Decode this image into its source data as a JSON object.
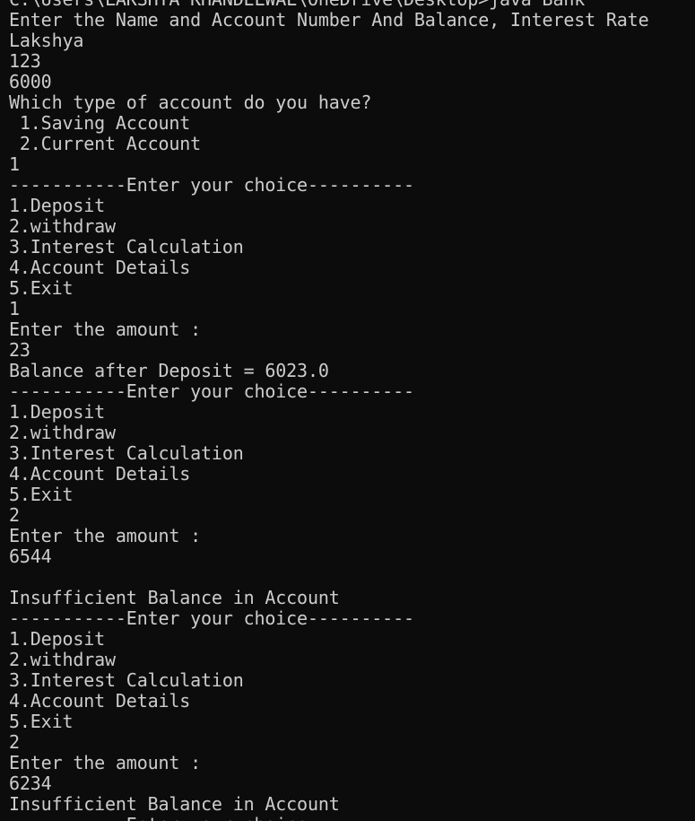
{
  "console": {
    "lines": [
      "C:\\Users\\LAKSHYA KHANDELWAL\\OneDrive\\Desktop>java Bank",
      "Enter the Name and Account Number And Balance, Interest Rate",
      "Lakshya",
      "123",
      "6000",
      "Which type of account do you have?",
      " 1.Saving Account",
      " 2.Current Account",
      "1",
      "-----------Enter your choice----------",
      "1.Deposit",
      "2.withdraw",
      "3.Interest Calculation",
      "4.Account Details",
      "5.Exit",
      "1",
      "Enter the amount :",
      "23",
      "Balance after Deposit = 6023.0",
      "-----------Enter your choice----------",
      "1.Deposit",
      "2.withdraw",
      "3.Interest Calculation",
      "4.Account Details",
      "5.Exit",
      "2",
      "Enter the amount :",
      "6544",
      "",
      "Insufficient Balance in Account",
      "-----------Enter your choice----------",
      "1.Deposit",
      "2.withdraw",
      "3.Interest Calculation",
      "4.Account Details",
      "5.Exit",
      "2",
      "Enter the amount :",
      "6234",
      "Insufficient Balance in Account",
      "-----------Enter your choice----------"
    ]
  }
}
